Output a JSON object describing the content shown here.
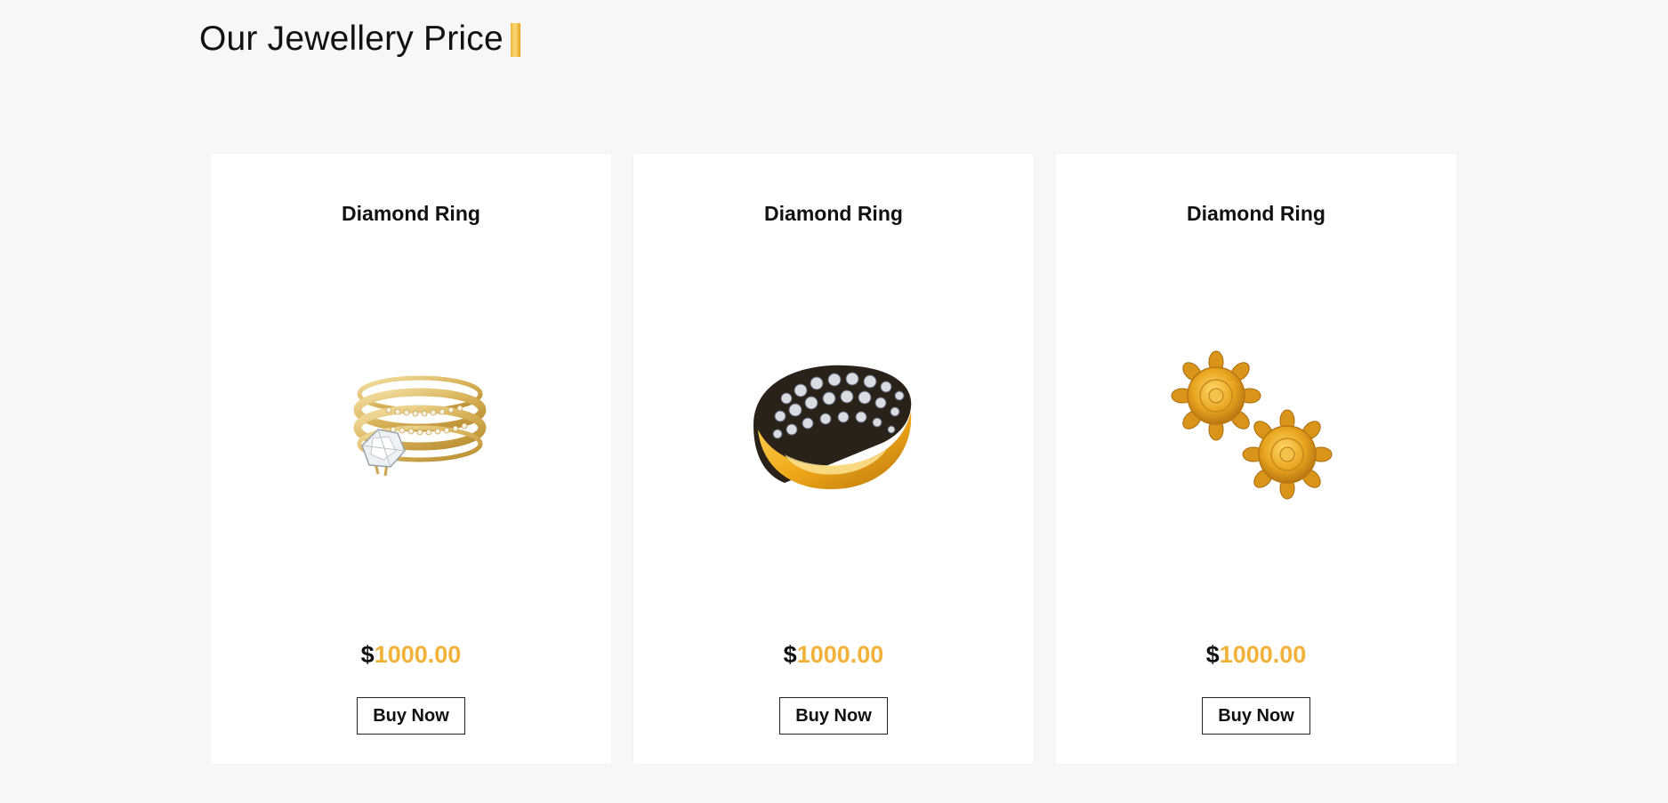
{
  "section": {
    "title": "Our Jewellery Price"
  },
  "colors": {
    "accent": "#f2b23a",
    "background": "#f7f7f7",
    "card": "#ffffff"
  },
  "products": [
    {
      "name": "Diamond Ring",
      "currency": "$",
      "amount": "1000.00",
      "button_label": "Buy Now",
      "image": "gold-diamond-engagement-ring-image"
    },
    {
      "name": "Diamond Ring",
      "currency": "$",
      "amount": "1000.00",
      "button_label": "Buy Now",
      "image": "gold-studded-diamond-band-image"
    },
    {
      "name": "Diamond Ring",
      "currency": "$",
      "amount": "1000.00",
      "button_label": "Buy Now",
      "image": "gold-flower-stud-earrings-image"
    }
  ]
}
